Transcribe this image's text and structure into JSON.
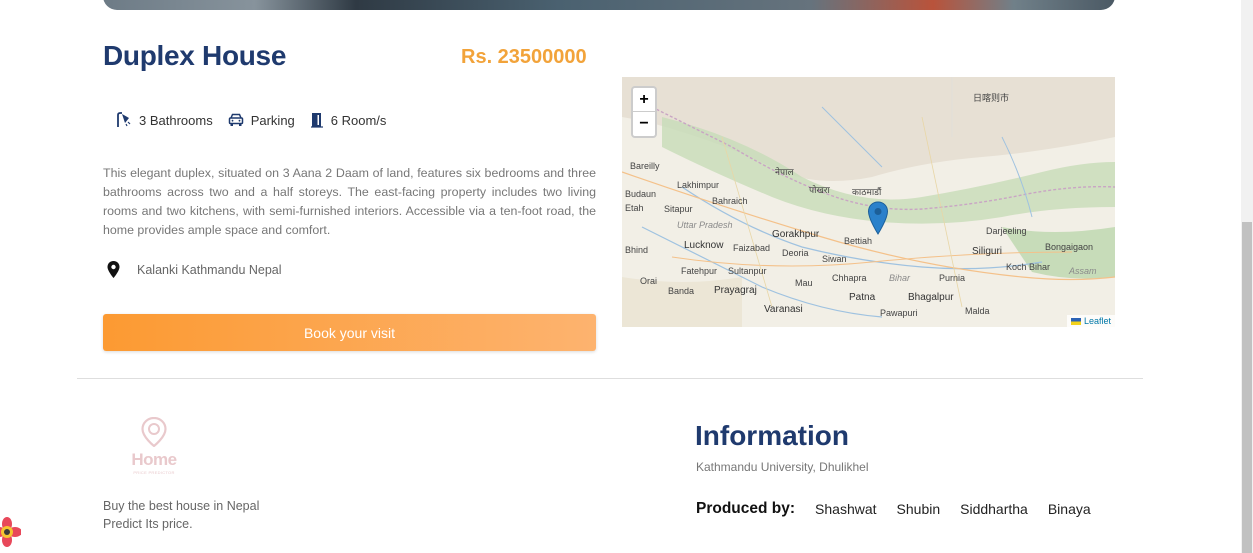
{
  "property": {
    "title": "Duplex House",
    "price": "Rs. 23500000",
    "features": [
      {
        "icon": "shower-icon",
        "label": "3 Bathrooms"
      },
      {
        "icon": "car-icon",
        "label": "Parking"
      },
      {
        "icon": "door-icon",
        "label": "6 Room/s"
      }
    ],
    "description": "This elegant duplex, situated on 3 Aana 2 Daam of land, features six bedrooms and three bathrooms across two and a half storeys. The east-facing property includes two living rooms and two kitchens, with semi-furnished interiors. Accessible via a ten-foot road, the home provides ample space and comfort.",
    "location": "Kalanki Kathmandu Nepal",
    "book_label": "Book your visit"
  },
  "map": {
    "zoom_in": "+",
    "zoom_out": "−",
    "attribution": "Leaflet",
    "labels": {
      "bareilly": "Bareilly",
      "lakhimpur": "Lakhimpur",
      "sitapur": "Sitapur",
      "bahraich": "Bahraich",
      "gorakhpur": "Gorakhpur",
      "lucknow": "Lucknow",
      "faizabad": "Faizabad",
      "deoria": "Deoria",
      "bettiah": "Bettiah",
      "siwan": "Siwan",
      "chhapra": "Chhapra",
      "fatehpur": "Fatehpur",
      "sultanpur": "Sultanpur",
      "mau": "Mau",
      "banda": "Banda",
      "prayagraj": "Prayagraj",
      "varanasi": "Varanasi",
      "patna": "Patna",
      "bhagalpur": "Bhagalpur",
      "purnia": "Purnia",
      "siliguri": "Siliguri",
      "darjeeling": "Darjeeling",
      "bongaigaon": "Bongaigaon",
      "koch_bihar": "Koch Bihar",
      "assam": "Assam",
      "bihar": "Bihar",
      "malda": "Malda",
      "pawapuri": "Pawapuri",
      "orai": "Orai",
      "bhind": "Bhind",
      "etah": "Etah",
      "budaun": "Budaun",
      "uttar_pradesh": "Uttar Pradesh",
      "kathmandu": "काठमाडौं",
      "pokhara": "पोखरा",
      "nepal": "नेपाल",
      "shigatse": "日喀则市"
    }
  },
  "footer": {
    "logo_text": "Home",
    "logo_sub": "PRICE PREDICTOR",
    "tagline_line1": "Buy the best house in Nepal",
    "tagline_line2": "Predict Its price.",
    "info_title": "Information",
    "info_sub": "Kathmandu University, Dhulikhel",
    "produced_label": "Produced by:",
    "producers": [
      "Shashwat",
      "Shubin",
      "Siddhartha",
      "Binaya"
    ]
  },
  "colors": {
    "title": "#1f3a6e",
    "price": "#f2a33a",
    "button_start": "#fc9a32",
    "button_end": "#fdb36f",
    "marker": "#2a81cb"
  }
}
